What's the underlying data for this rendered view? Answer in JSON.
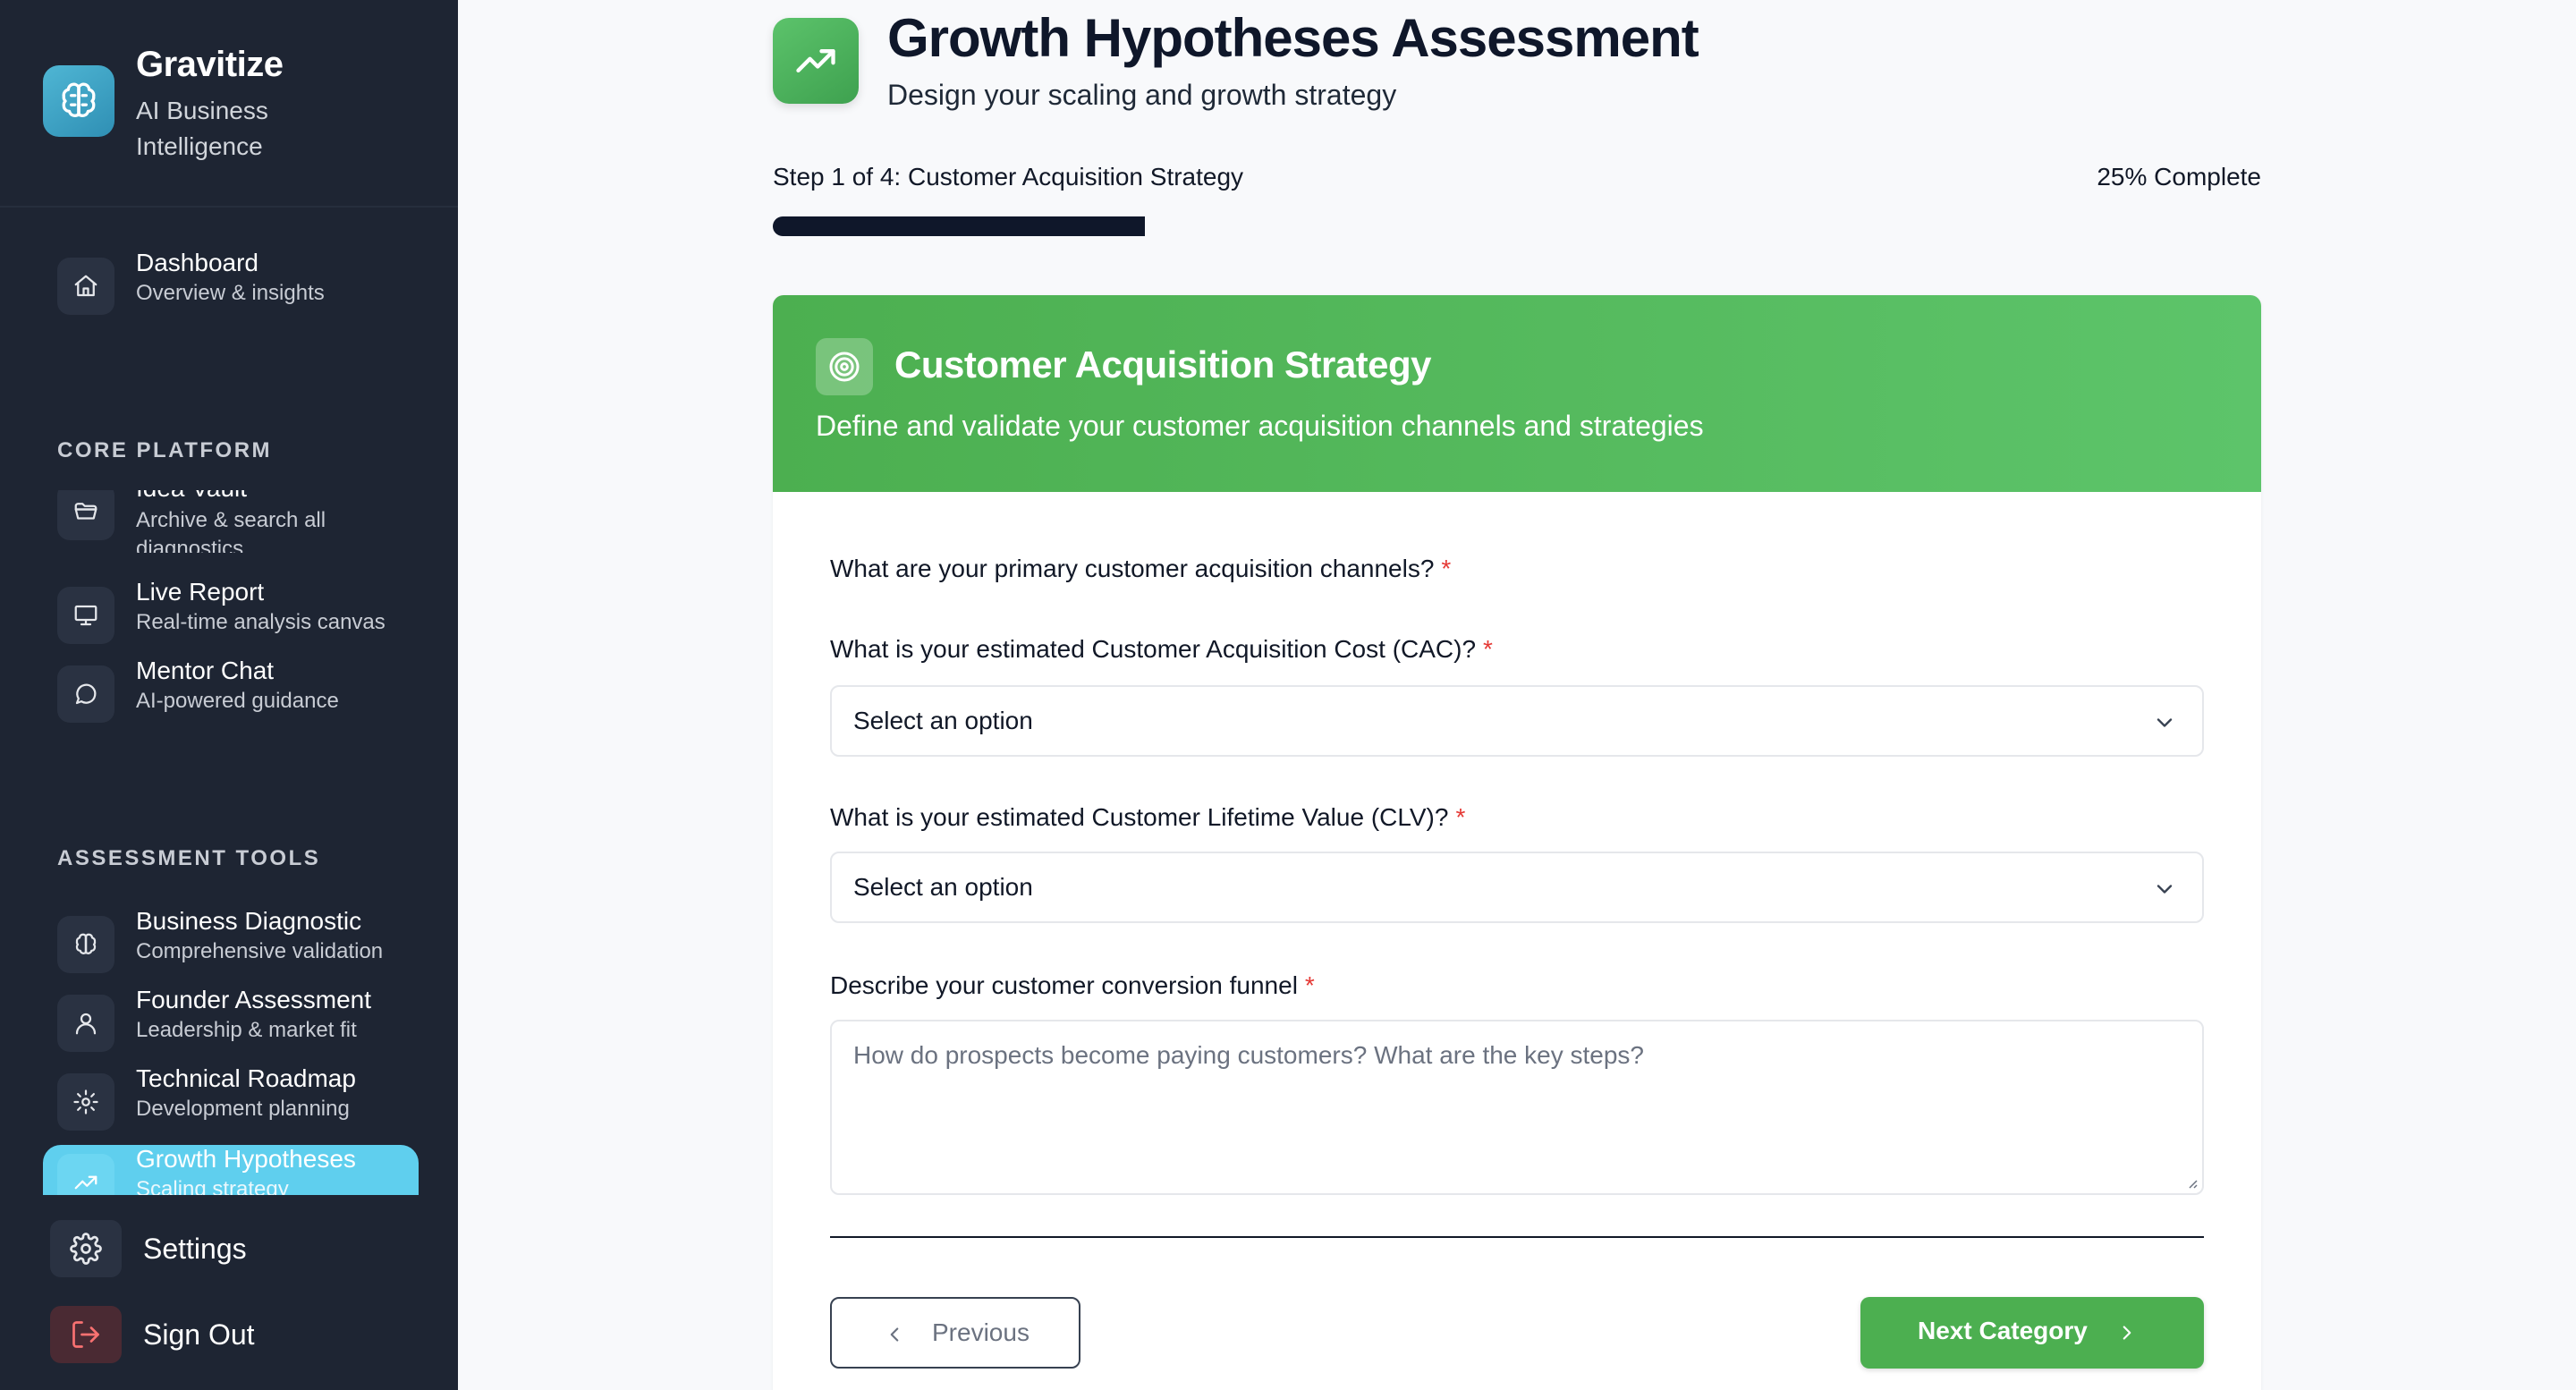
{
  "brand": {
    "name": "Gravitize",
    "tagline": "AI Business Intelligence",
    "logo_icon": "brain-icon"
  },
  "nav": {
    "dashboard": {
      "title": "Dashboard",
      "sub": "Overview & insights",
      "icon": "home-icon"
    },
    "core_platform_label": "CORE PLATFORM",
    "core": [
      {
        "title": "Idea Vault",
        "sub": "Archive & search all diagnostics",
        "icon": "folder-icon"
      },
      {
        "title": "Live Report",
        "sub": "Real-time analysis canvas",
        "icon": "monitor-icon"
      },
      {
        "title": "Mentor Chat",
        "sub": "AI-powered guidance",
        "icon": "chat-icon"
      }
    ],
    "assessment_tools_label": "ASSESSMENT TOOLS",
    "tools": [
      {
        "title": "Business Diagnostic",
        "sub": "Comprehensive validation",
        "icon": "brain-icon"
      },
      {
        "title": "Founder Assessment",
        "sub": "Leadership & market fit",
        "icon": "user-icon"
      },
      {
        "title": "Technical Roadmap",
        "sub": "Development planning",
        "icon": "gear-icon"
      },
      {
        "title": "Growth Hypotheses",
        "sub": "Scaling strategy",
        "icon": "trending-up-icon",
        "active": true
      }
    ],
    "settings": "Settings",
    "sign_out": "Sign Out"
  },
  "header": {
    "title": "Growth Hypotheses Assessment",
    "subtitle": "Design your scaling and growth strategy",
    "icon": "trending-up-icon"
  },
  "progress": {
    "step_label": "Step 1 of 4: Customer Acquisition Strategy",
    "percent_label": "25% Complete",
    "percent": 25
  },
  "card": {
    "title": "Customer Acquisition Strategy",
    "description": "Define and validate your customer acquisition channels and strategies",
    "icon": "target-icon",
    "q1": {
      "label": "What are your primary customer acquisition channels?",
      "required": "*"
    },
    "q2": {
      "label": "What is your estimated Customer Acquisition Cost (CAC)?",
      "required": "*",
      "value": "Select an option"
    },
    "q3": {
      "label": "What is your estimated Customer Lifetime Value (CLV)?",
      "required": "*",
      "value": "Select an option"
    },
    "q4": {
      "label": "Describe your customer conversion funnel",
      "required": "*",
      "placeholder": "How do prospects become paying customers? What are the key steps?"
    },
    "prev_label": "Previous",
    "next_label": "Next Category"
  },
  "colors": {
    "sidebar_bg": "#1e2533",
    "accent_green": "#4caf50",
    "active_cyan": "#5fcfee",
    "required_red": "#e53935"
  }
}
